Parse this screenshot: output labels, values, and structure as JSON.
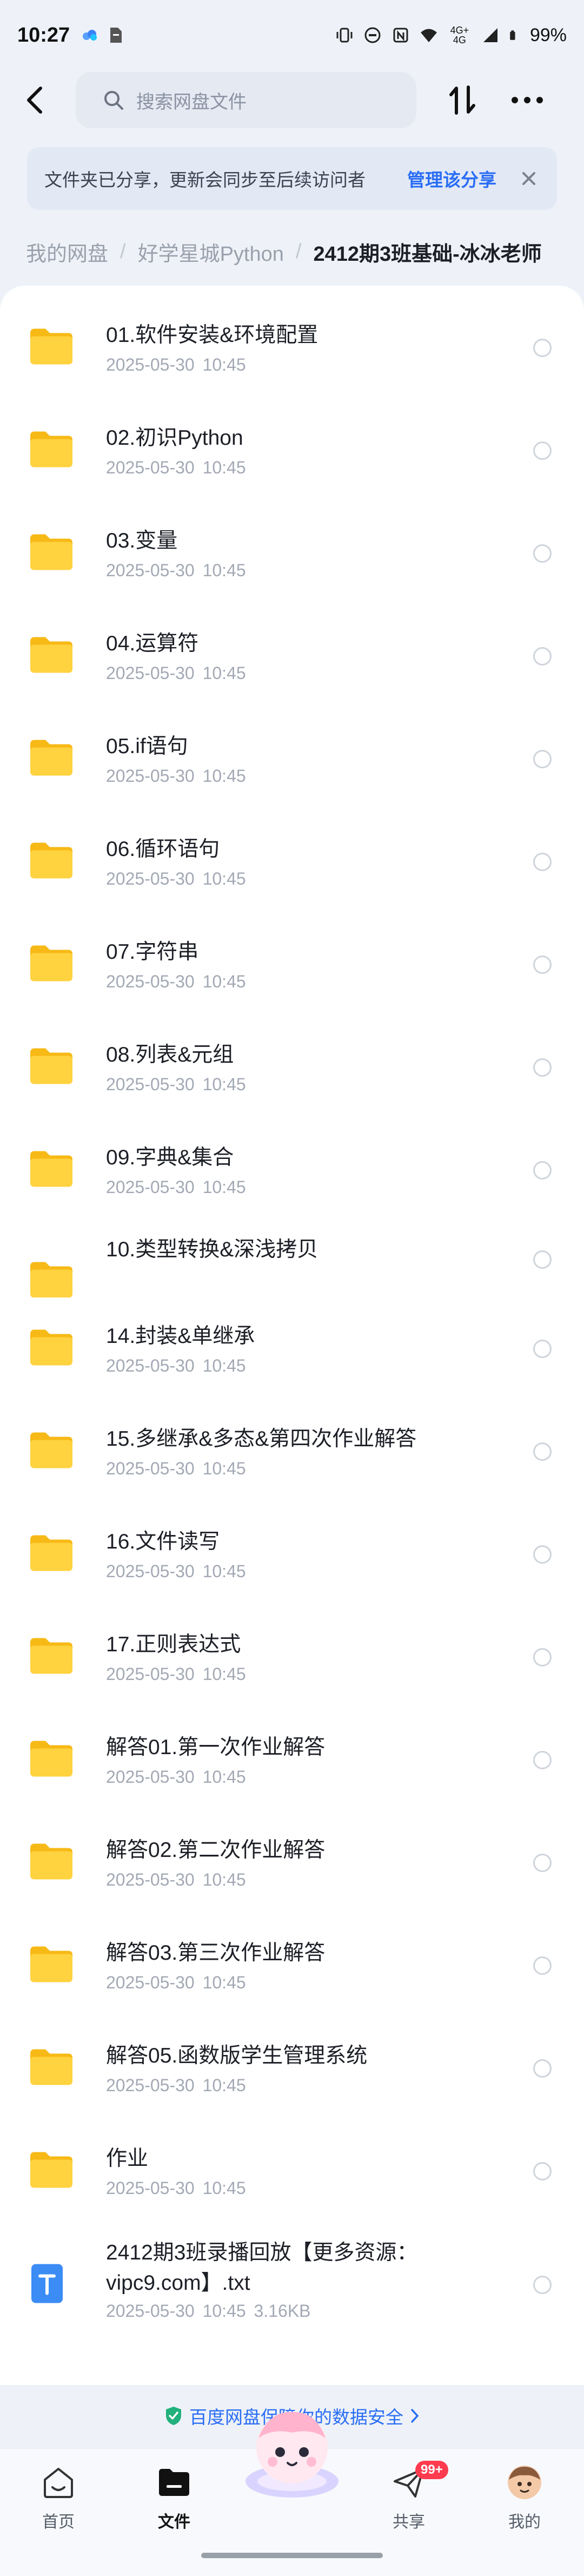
{
  "status_bar": {
    "time": "10:27",
    "battery": "99%",
    "network": "4G+ 4G"
  },
  "search": {
    "placeholder": "搜索网盘文件"
  },
  "notice": {
    "text": "文件夹已分享，更新会同步至后续访问者",
    "action": "管理该分享"
  },
  "breadcrumb": {
    "root": "我的网盘",
    "parent": "好学星城Python",
    "current": "2412期3班基础-冰冰老师"
  },
  "files": [
    {
      "name": "01.软件安装&环境配置",
      "meta": "2025-05-30  10:45",
      "type": "folder"
    },
    {
      "name": "02.初识Python",
      "meta": "2025-05-30  10:45",
      "type": "folder"
    },
    {
      "name": "03.变量",
      "meta": "2025-05-30  10:45",
      "type": "folder"
    },
    {
      "name": "04.运算符",
      "meta": "2025-05-30  10:45",
      "type": "folder"
    },
    {
      "name": "05.if语句",
      "meta": "2025-05-30  10:45",
      "type": "folder"
    },
    {
      "name": "06.循环语句",
      "meta": "2025-05-30  10:45",
      "type": "folder"
    },
    {
      "name": "07.字符串",
      "meta": "2025-05-30  10:45",
      "type": "folder"
    },
    {
      "name": "08.列表&元组",
      "meta": "2025-05-30  10:45",
      "type": "folder"
    },
    {
      "name": "09.字典&集合",
      "meta": "2025-05-30  10:45",
      "type": "folder"
    },
    {
      "name": "10.类型转换&深浅拷贝",
      "meta": "",
      "type": "folder"
    },
    {
      "name": "14.封装&单继承",
      "meta": "2025-05-30  10:45",
      "type": "folder"
    },
    {
      "name": "15.多继承&多态&第四次作业解答",
      "meta": "2025-05-30  10:45",
      "type": "folder"
    },
    {
      "name": "16.文件读写",
      "meta": "2025-05-30  10:45",
      "type": "folder"
    },
    {
      "name": "17.正则表达式",
      "meta": "2025-05-30  10:45",
      "type": "folder"
    },
    {
      "name": "解答01.第一次作业解答",
      "meta": "2025-05-30  10:45",
      "type": "folder"
    },
    {
      "name": "解答02.第二次作业解答",
      "meta": "2025-05-30  10:45",
      "type": "folder"
    },
    {
      "name": "解答03.第三次作业解答",
      "meta": "2025-05-30  10:45",
      "type": "folder"
    },
    {
      "name": "解答05.函数版学生管理系统",
      "meta": "2025-05-30  10:45",
      "type": "folder"
    },
    {
      "name": "作业",
      "meta": "2025-05-30  10:45",
      "type": "folder"
    },
    {
      "name_line1": "2412期3班录播回放【更多资源：",
      "name_line2": "vipc9.com】.txt",
      "meta": "2025-05-30  10:45  3.16KB",
      "type": "txt"
    }
  ],
  "footer": {
    "security_text": "百度网盘保障你的数据安全"
  },
  "tabbar": {
    "tabs": [
      {
        "label": "首页"
      },
      {
        "label": "文件"
      },
      {
        "label": "共享",
        "badge": "99+"
      },
      {
        "label": "我的"
      }
    ]
  },
  "colors": {
    "accent": "#2a6df5",
    "folder": "#ffc928",
    "badge": "#ff3b4f"
  }
}
